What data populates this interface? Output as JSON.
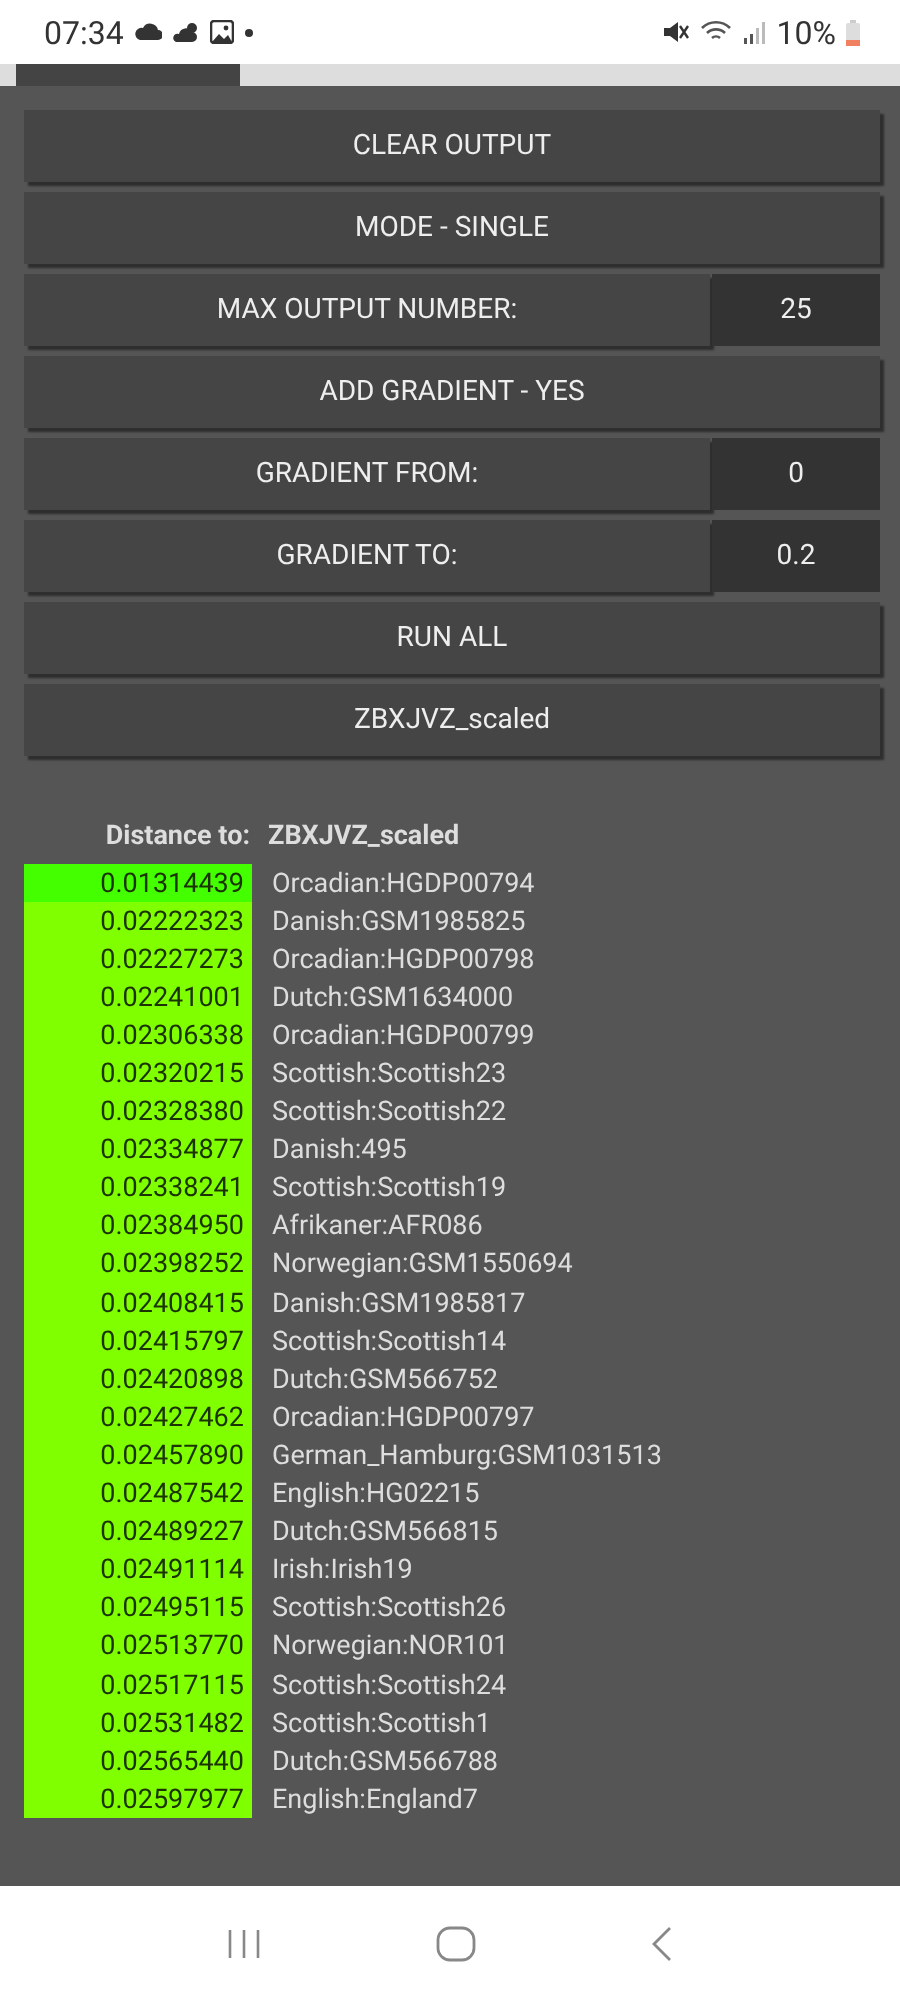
{
  "status_bar": {
    "time": "07:34",
    "battery": "10%"
  },
  "tabs": [
    {
      "selected": true
    }
  ],
  "controls": [
    {
      "kind": "button",
      "label": "CLEAR OUTPUT"
    },
    {
      "kind": "button",
      "label": "MODE - SINGLE"
    },
    {
      "kind": "input",
      "label": "MAX OUTPUT NUMBER:",
      "value": "25"
    },
    {
      "kind": "button",
      "label": "ADD GRADIENT - YES"
    },
    {
      "kind": "input",
      "label": "GRADIENT FROM:",
      "value": "0"
    },
    {
      "kind": "input",
      "label": "GRADIENT TO:",
      "value": "0.2"
    },
    {
      "kind": "button",
      "label": "RUN ALL"
    },
    {
      "kind": "button",
      "label": "ZBXJVZ_scaled"
    }
  ],
  "results": {
    "header_label": "Distance to:",
    "header_target": "ZBXJVZ_scaled",
    "rows": [
      {
        "distance": "0.01314439",
        "name": "Orcadian:HGDP00794",
        "color": "#44ff00"
      },
      {
        "distance": "0.02222323",
        "name": "Danish:GSM1985825",
        "color": "#80ff00"
      },
      {
        "distance": "0.02227273",
        "name": "Orcadian:HGDP00798",
        "color": "#80ff00"
      },
      {
        "distance": "0.02241001",
        "name": "Dutch:GSM1634000",
        "color": "#80ff00"
      },
      {
        "distance": "0.02306338",
        "name": "Orcadian:HGDP00799",
        "color": "#80ff00"
      },
      {
        "distance": "0.02320215",
        "name": "Scottish:Scottish23",
        "color": "#80ff00"
      },
      {
        "distance": "0.02328380",
        "name": "Scottish:Scottish22",
        "color": "#80ff00"
      },
      {
        "distance": "0.02334877",
        "name": "Danish:495",
        "color": "#80ff00"
      },
      {
        "distance": "0.02338241",
        "name": "Scottish:Scottish19",
        "color": "#80ff00"
      },
      {
        "distance": "0.02384950",
        "name": "Afrikaner:AFR086",
        "color": "#80ff00"
      },
      {
        "distance": "0.02398252",
        "name": "Norwegian:GSM1550694",
        "color": "#80ff00"
      },
      {
        "distance": "0.02408415",
        "name": "Danish:GSM1985817",
        "color": "#80ff00"
      },
      {
        "distance": "0.02415797",
        "name": "Scottish:Scottish14",
        "color": "#80ff00"
      },
      {
        "distance": "0.02420898",
        "name": "Dutch:GSM566752",
        "color": "#80ff00"
      },
      {
        "distance": "0.02427462",
        "name": "Orcadian:HGDP00797",
        "color": "#80ff00"
      },
      {
        "distance": "0.02457890",
        "name": "German_Hamburg:GSM1031513",
        "color": "#80ff00"
      },
      {
        "distance": "0.02487542",
        "name": "English:HG02215",
        "color": "#80ff00"
      },
      {
        "distance": "0.02489227",
        "name": "Dutch:GSM566815",
        "color": "#80ff00"
      },
      {
        "distance": "0.02491114",
        "name": "Irish:Irish19",
        "color": "#80ff00"
      },
      {
        "distance": "0.02495115",
        "name": "Scottish:Scottish26",
        "color": "#80ff00"
      },
      {
        "distance": "0.02513770",
        "name": "Norwegian:NOR101",
        "color": "#80ff00"
      },
      {
        "distance": "0.02517115",
        "name": "Scottish:Scottish24",
        "color": "#80ff00"
      },
      {
        "distance": "0.02531482",
        "name": "Scottish:Scottish1",
        "color": "#80ff00"
      },
      {
        "distance": "0.02565440",
        "name": "Dutch:GSM566788",
        "color": "#80ff00"
      },
      {
        "distance": "0.02597977",
        "name": "English:England7",
        "color": "#80ff00"
      }
    ]
  }
}
